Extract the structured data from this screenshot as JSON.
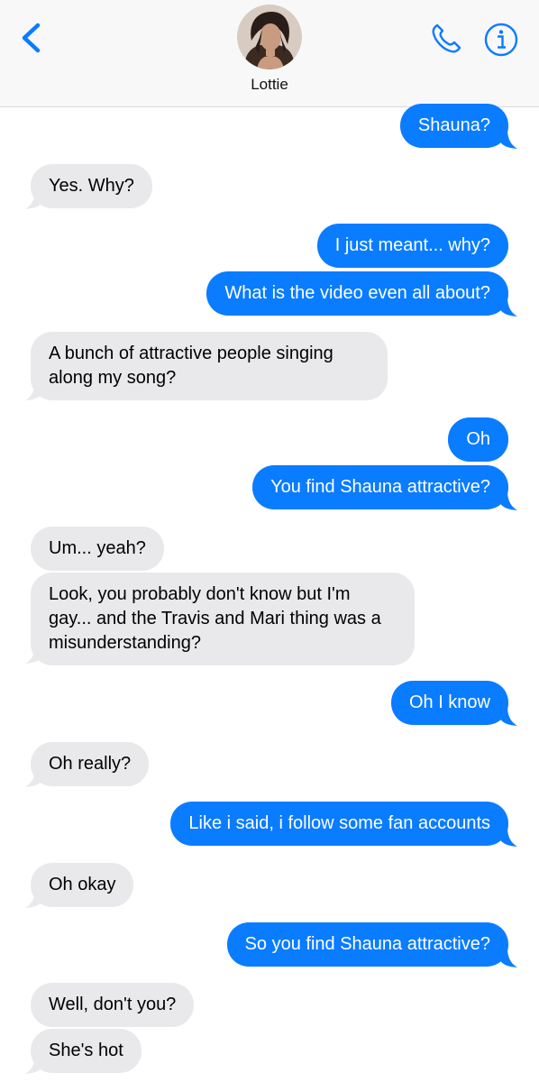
{
  "header": {
    "contact_name": "Lottie",
    "icons": {
      "back": "chevron-left-icon",
      "call": "phone-icon",
      "info": "info-icon"
    },
    "accent_color": "#0a7cff"
  },
  "messages": [
    {
      "direction": "sent",
      "text": "Shauna?"
    },
    {
      "direction": "received",
      "text": "Yes. Why?"
    },
    {
      "direction": "sent",
      "text": "I just meant... why?"
    },
    {
      "direction": "sent",
      "text": "What is the video even all about?"
    },
    {
      "direction": "received",
      "text": "A bunch of attractive people singing along my song?"
    },
    {
      "direction": "sent",
      "text": "Oh"
    },
    {
      "direction": "sent",
      "text": "You find Shauna attractive?"
    },
    {
      "direction": "received",
      "text": "Um... yeah?"
    },
    {
      "direction": "received",
      "text": "Look, you probably don't know but I'm gay... and the Travis and Mari thing was a misunderstanding?"
    },
    {
      "direction": "sent",
      "text": "Oh I know"
    },
    {
      "direction": "received",
      "text": "Oh really?"
    },
    {
      "direction": "sent",
      "text": "Like i said, i follow some fan accounts"
    },
    {
      "direction": "received",
      "text": "Oh okay"
    },
    {
      "direction": "sent",
      "text": "So you find Shauna attractive?"
    },
    {
      "direction": "received",
      "text": "Well, don't you?"
    },
    {
      "direction": "received",
      "text": "She's hot"
    }
  ],
  "colors": {
    "sent_bubble": "#0a7cff",
    "received_bubble": "#e9e9eb",
    "header_background": "#f8f8f8"
  }
}
